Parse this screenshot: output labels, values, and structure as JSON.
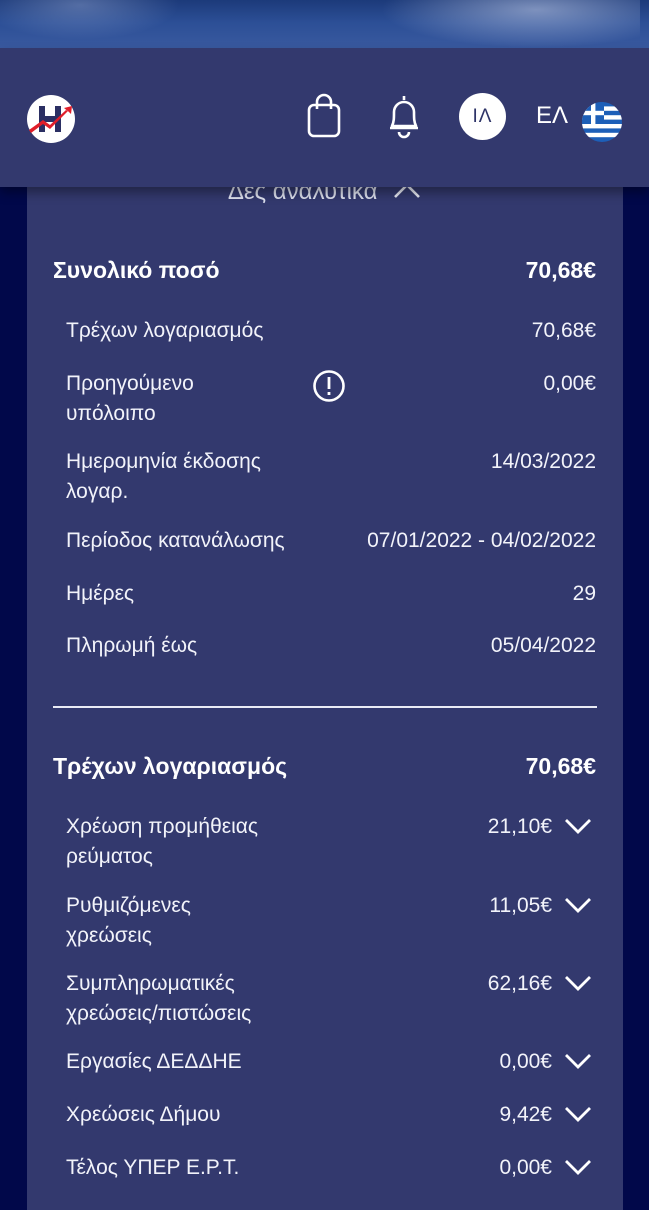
{
  "header": {
    "avatar_initials": "ΙΛ",
    "language": "ΕΛ"
  },
  "panel": {
    "toggle_label": "Δες αναλυτικά",
    "summary": {
      "title": "Συνολικό ποσό",
      "amount": "70,68€",
      "rows": [
        {
          "label": "Τρέχων λογαριασμός",
          "value": "70,68€"
        },
        {
          "label": "Προηγούμενο\nυπόλοιπο",
          "value": "0,00€"
        },
        {
          "label": "Ημερομηνία έκδοσης\nλογαρ.",
          "value": "14/03/2022"
        },
        {
          "label": "Περίοδος κατανάλωσης",
          "value": "07/01/2022 - 04/02/2022"
        },
        {
          "label": "Ημέρες",
          "value": "29"
        },
        {
          "label": "Πληρωμή έως",
          "value": "05/04/2022"
        }
      ]
    },
    "current": {
      "title": "Τρέχων λογαριασμός",
      "amount": "70,68€",
      "rows": [
        {
          "label": "Χρέωση προμήθειας\nρεύματος",
          "value": "21,10€"
        },
        {
          "label": "Ρυθμιζόμενες\nχρεώσεις",
          "value": "11,05€"
        },
        {
          "label": "Συμπληρωματικές\nχρεώσεις/πιστώσεις",
          "value": "62,16€"
        },
        {
          "label": "Εργασίες ΔΕΔΔΗΕ",
          "value": "0,00€"
        },
        {
          "label": "Χρεώσεις Δήμου",
          "value": "9,42€"
        },
        {
          "label": "Τέλος ΥΠΕΡ Ε.Ρ.Τ.",
          "value": "0,00€"
        }
      ]
    }
  },
  "colors": {
    "topbar": "#33396e",
    "panel": "#33396e",
    "background": "#01084a",
    "logo_accent": "#e01e2a"
  }
}
